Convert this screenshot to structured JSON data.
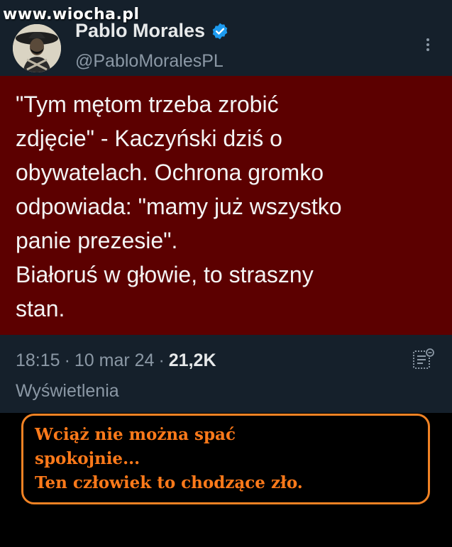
{
  "watermark": "www.wiocha.pl",
  "profile": {
    "display_name": "Pablo Morales",
    "handle": "@PabloMoralesPL",
    "avatar_icon": "avatar-portrait",
    "verified_icon": "verified-badge-icon",
    "verified_color": "#1d9bf0"
  },
  "tweet": {
    "text": "\"Tym mętom trzeba zrobić\nzdjęcie\" - Kaczyński dziś o\nobywatelach. Ochrona gromko\nodpowiada: \"mamy już wszystko\npanie prezesie\".\nBiałoruś w głowie, to straszny\nstan.",
    "highlight_color": "#5c0000"
  },
  "meta": {
    "time": "18:15",
    "separator": "·",
    "date": "10 mar 24",
    "views_count": "21,2K",
    "views_label": "Wyświetlenia"
  },
  "caption": {
    "text": "Wciąż nie można spać\nspokojnie...\nTen człowiek to chodzące zło.",
    "border_color": "#f08224",
    "text_color": "#ff7a1a"
  },
  "colors": {
    "tweet_bg": "#15202b",
    "page_bg": "#000000",
    "secondary_text": "#8b98a5"
  }
}
